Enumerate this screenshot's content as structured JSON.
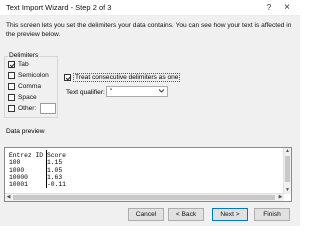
{
  "window": {
    "title": "Text Import Wizard - Step 2 of 3",
    "help_glyph": "?",
    "close_glyph": "×"
  },
  "description": "This screen lets you set the delimiters your data contains.  You can see how your text is affected in the preview below.",
  "delimiters": {
    "group_label": "Delimiters",
    "tab": {
      "label": "Tab",
      "checked": true
    },
    "semicolon": {
      "label": "Semicolon",
      "checked": false
    },
    "comma": {
      "label": "Comma",
      "checked": false
    },
    "space": {
      "label": "Space",
      "checked": false
    },
    "other": {
      "label": "Other:",
      "checked": false,
      "value": ""
    }
  },
  "consecutive": {
    "label": "Treat consecutive delimiters as one",
    "checked": true
  },
  "qualifier": {
    "label": "Text qualifier:",
    "value": "\""
  },
  "preview": {
    "label": "Data preview",
    "rows": [
      [
        "Entrez ID",
        "Score"
      ],
      [
        "100",
        "1.15"
      ],
      [
        "1000",
        "1.05"
      ],
      [
        "10000",
        "1.63"
      ],
      [
        "10001",
        "-0.11"
      ]
    ]
  },
  "buttons": {
    "cancel": "Cancel",
    "back": "< Back",
    "next": "Next >",
    "finish": "Finish"
  },
  "icons": {
    "help": "question-mark-icon",
    "close": "close-icon",
    "dropdown": "chevron-down-icon"
  }
}
